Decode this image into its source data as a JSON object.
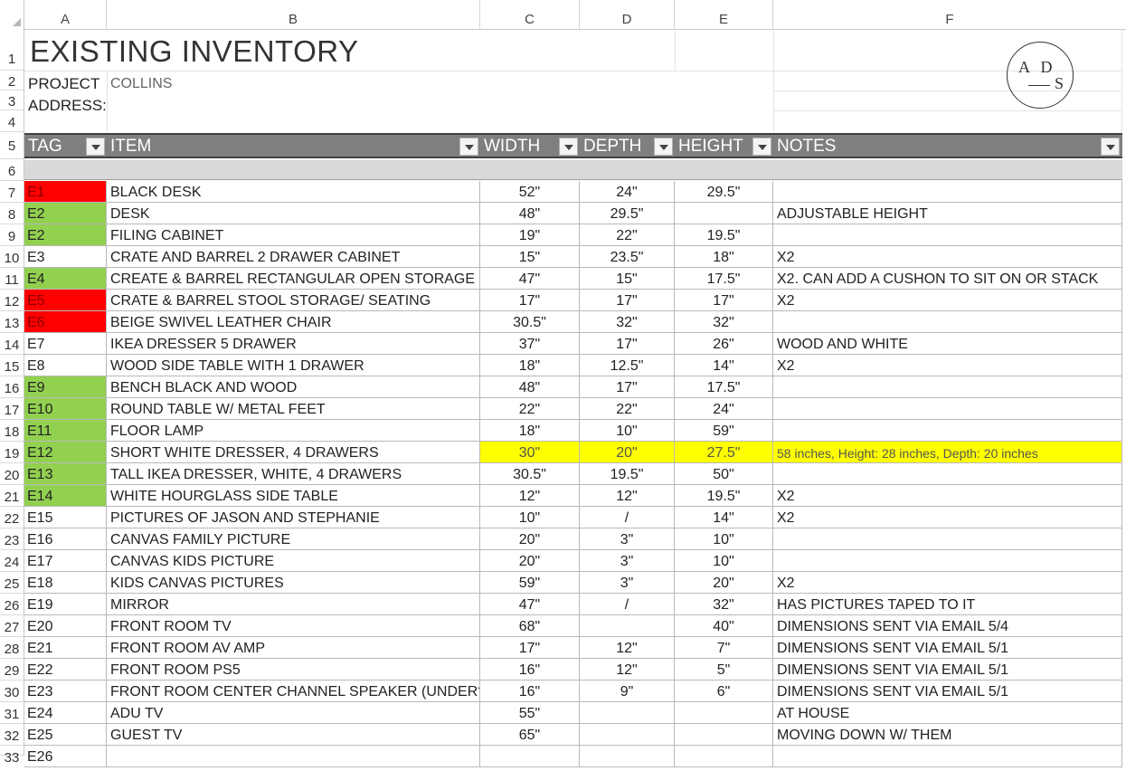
{
  "column_headers": [
    "A",
    "B",
    "C",
    "D",
    "E",
    "F"
  ],
  "row_numbers": [
    "1",
    "2",
    "3",
    "4",
    "5",
    "6",
    "7",
    "8",
    "9",
    "10",
    "11",
    "12",
    "13",
    "14",
    "15",
    "16",
    "17",
    "18",
    "19",
    "20",
    "21",
    "22",
    "23",
    "24",
    "25",
    "26",
    "27",
    "28",
    "29",
    "30",
    "31",
    "32",
    "33"
  ],
  "sheet": {
    "title": "EXISTING INVENTORY",
    "project_label": "PROJECT",
    "project_value": "COLLINS",
    "address_label": "ADDRESS:",
    "logo_top": "A D",
    "logo_bottom": "S"
  },
  "table_headers": {
    "tag": "TAG",
    "item": "ITEM",
    "width": "WIDTH",
    "depth": "DEPTH",
    "height": "HEIGHT",
    "notes": "NOTES"
  },
  "colors": {
    "red": "#ff0000",
    "green": "#92d050",
    "yellow": "#ffff00",
    "header_band": "#7f7f7f",
    "row6_band": "#d9d9d9"
  },
  "rows": [
    {
      "tag": "E1",
      "item": "BLACK DESK",
      "width": "52\"",
      "depth": "24\"",
      "height": "29.5\"",
      "notes": "",
      "tag_color": "red"
    },
    {
      "tag": "E2",
      "item": "DESK",
      "width": "48\"",
      "depth": "29.5\"",
      "height": "",
      "notes": "ADJUSTABLE HEIGHT",
      "tag_color": "green"
    },
    {
      "tag": "E2",
      "item": "FILING CABINET",
      "width": "19\"",
      "depth": "22\"",
      "height": "19.5\"",
      "notes": "",
      "tag_color": "green"
    },
    {
      "tag": "E3",
      "item": "CRATE AND BARREL  2 DRAWER CABINET",
      "width": "15\"",
      "depth": "23.5\"",
      "height": "18\"",
      "notes": "X2",
      "tag_color": ""
    },
    {
      "tag": "E4",
      "item": "CREATE & BARREL RECTANGULAR OPEN STORAGE",
      "width": "47\"",
      "depth": "15\"",
      "height": "17.5\"",
      "notes": "X2. CAN ADD A CUSHON TO SIT ON OR STACK",
      "tag_color": "green"
    },
    {
      "tag": "E5",
      "item": "CRATE & BARREL STOOL STORAGE/ SEATING",
      "width": "17\"",
      "depth": "17\"",
      "height": "17\"",
      "notes": "X2",
      "tag_color": "red"
    },
    {
      "tag": "E6",
      "item": "BEIGE SWIVEL LEATHER CHAIR",
      "width": "30.5\"",
      "depth": "32\"",
      "height": "32\"",
      "notes": "",
      "tag_color": "red"
    },
    {
      "tag": "E7",
      "item": "IKEA DRESSER 5 DRAWER",
      "width": "37\"",
      "depth": "17\"",
      "height": "26\"",
      "notes": "WOOD AND WHITE",
      "tag_color": ""
    },
    {
      "tag": "E8",
      "item": "WOOD SIDE TABLE WITH 1 DRAWER",
      "width": "18\"",
      "depth": "12.5\"",
      "height": "14\"",
      "notes": "X2",
      "tag_color": ""
    },
    {
      "tag": "E9",
      "item": "BENCH BLACK AND WOOD",
      "width": "48\"",
      "depth": "17\"",
      "height": "17.5\"",
      "notes": "",
      "tag_color": "green"
    },
    {
      "tag": "E10",
      "item": "ROUND TABLE W/ METAL FEET",
      "width": "22\"",
      "depth": "22\"",
      "height": "24\"",
      "notes": "",
      "tag_color": "green"
    },
    {
      "tag": "E11",
      "item": "FLOOR LAMP",
      "width": "18\"",
      "depth": "10\"",
      "height": "59\"",
      "notes": "",
      "tag_color": "green"
    },
    {
      "tag": "E12",
      "item": "SHORT WHITE DRESSER, 4 DRAWERS",
      "width": "30\"",
      "depth": "20\"",
      "height": "27.5\"",
      "notes": "58 inches, Height: 28 inches, Depth: 20 inches",
      "tag_color": "green",
      "highlight": true
    },
    {
      "tag": "E13",
      "item": "TALL IKEA DRESSER, WHITE, 4 DRAWERS",
      "width": "30.5\"",
      "depth": "19.5\"",
      "height": "50\"",
      "notes": "",
      "tag_color": "green"
    },
    {
      "tag": "E14",
      "item": "WHITE HOURGLASS SIDE TABLE",
      "width": "12\"",
      "depth": "12\"",
      "height": "19.5\"",
      "notes": "X2",
      "tag_color": "green"
    },
    {
      "tag": "E15",
      "item": "PICTURES OF JASON AND STEPHANIE",
      "width": "10\"",
      "depth": "/",
      "height": "14\"",
      "notes": "X2",
      "tag_color": ""
    },
    {
      "tag": "E16",
      "item": "CANVAS FAMILY PICTURE",
      "width": "20\"",
      "depth": "3\"",
      "height": "10\"",
      "notes": "",
      "tag_color": ""
    },
    {
      "tag": "E17",
      "item": "CANVAS KIDS PICTURE",
      "width": "20\"",
      "depth": "3\"",
      "height": "10\"",
      "notes": "",
      "tag_color": ""
    },
    {
      "tag": "E18",
      "item": "KIDS CANVAS PICTURES",
      "width": "59\"",
      "depth": "3\"",
      "height": "20\"",
      "notes": "X2",
      "tag_color": ""
    },
    {
      "tag": "E19",
      "item": "MIRROR",
      "width": "47\"",
      "depth": "/",
      "height": "32\"",
      "notes": "HAS PICTURES TAPED TO IT",
      "tag_color": ""
    },
    {
      "tag": "E20",
      "item": "FRONT ROOM TV",
      "width": "68\"",
      "depth": "",
      "height": "40\"",
      "notes": "DIMENSIONS SENT VIA EMAIL 5/4",
      "tag_color": ""
    },
    {
      "tag": "E21",
      "item": "FRONT ROOM AV AMP",
      "width": "17\"",
      "depth": "12\"",
      "height": "7\"",
      "notes": "DIMENSIONS SENT VIA EMAIL 5/1",
      "tag_color": ""
    },
    {
      "tag": "E22",
      "item": "FRONT ROOM PS5",
      "width": "16\"",
      "depth": "12\"",
      "height": "5\"",
      "notes": "DIMENSIONS SENT VIA EMAIL 5/1",
      "tag_color": ""
    },
    {
      "tag": "E23",
      "item": "FRONT ROOM CENTER CHANNEL SPEAKER (UNDER?)",
      "width": "16\"",
      "depth": "9\"",
      "height": "6\"",
      "notes": "DIMENSIONS SENT VIA EMAIL 5/1",
      "tag_color": ""
    },
    {
      "tag": "E24",
      "item": "ADU TV",
      "width": "55\"",
      "depth": "",
      "height": "",
      "notes": "AT HOUSE",
      "tag_color": ""
    },
    {
      "tag": "E25",
      "item": "GUEST TV",
      "width": "65\"",
      "depth": "",
      "height": "",
      "notes": "MOVING DOWN W/ THEM",
      "tag_color": ""
    },
    {
      "tag": "E26",
      "item": "",
      "width": "",
      "depth": "",
      "height": "",
      "notes": "",
      "tag_color": ""
    }
  ]
}
